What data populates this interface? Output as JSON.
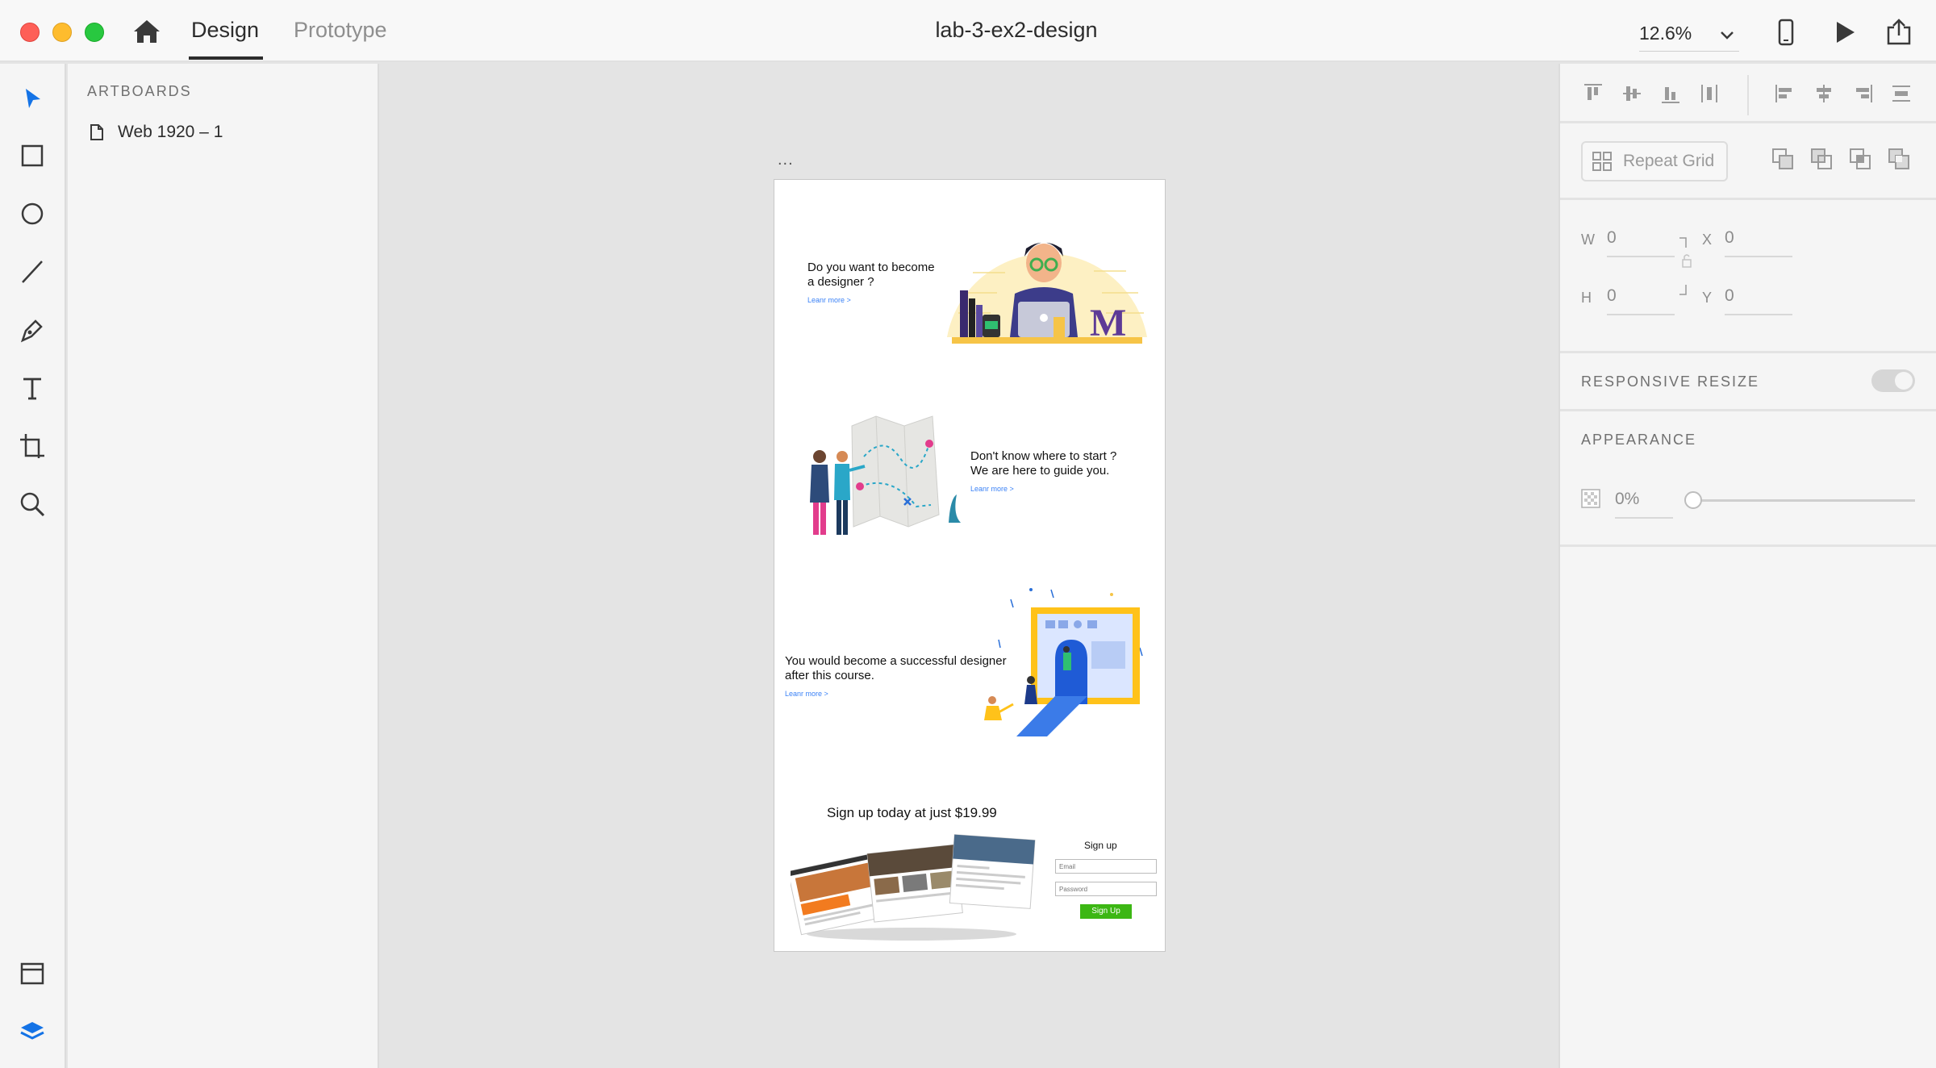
{
  "window": {
    "title": "lab-3-ex2-design",
    "tabs": [
      {
        "label": "Design",
        "active": true
      },
      {
        "label": "Prototype",
        "active": false
      }
    ],
    "zoom": "12.6%"
  },
  "layers": {
    "heading": "ARTBOARDS",
    "items": [
      {
        "label": "Web 1920 – 1"
      }
    ]
  },
  "artboard": {
    "menu": "...",
    "sections": [
      {
        "heading": "Do you want to become\na designer ?",
        "link": "Leanr more >"
      },
      {
        "heading": "Don't know where to start ?\nWe are here to guide you.",
        "link": "Leanr more >"
      },
      {
        "heading": "You would become a successful designer\nafter this course.",
        "link": "Leanr more >"
      }
    ],
    "signup": {
      "headline": "Sign up today at just $19.99",
      "form_title": "Sign up",
      "email_placeholder": "Email",
      "password_placeholder": "Password",
      "button_label": "Sign Up"
    },
    "illustration_letter": "M"
  },
  "properties": {
    "repeat_grid_label": "Repeat Grid",
    "fields": {
      "w_label": "W",
      "w": "0",
      "h_label": "H",
      "h": "0",
      "x_label": "X",
      "x": "0",
      "y_label": "Y",
      "y": "0"
    },
    "responsive_resize_label": "RESPONSIVE RESIZE",
    "appearance_label": "APPEARANCE",
    "opacity": "0%"
  },
  "colors": {
    "accent_blue": "#1473e6",
    "signup_green": "#3cb714",
    "link_blue": "#3b82f6"
  }
}
